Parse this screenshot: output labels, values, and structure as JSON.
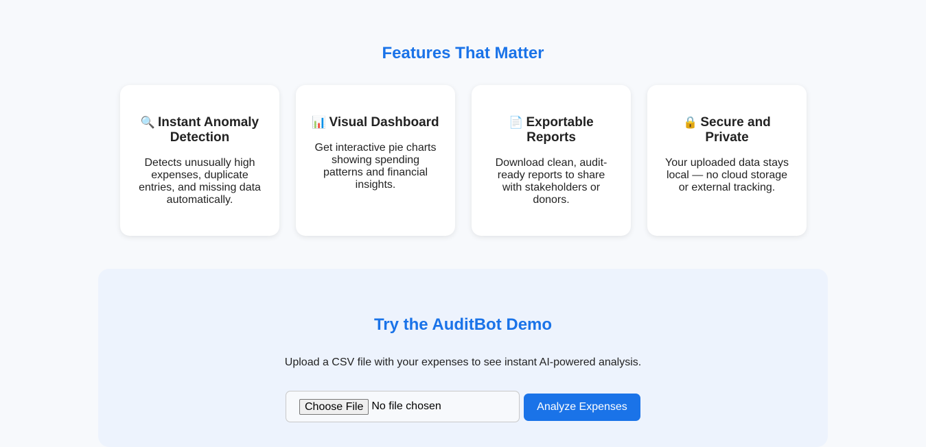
{
  "features": {
    "title": "Features That Matter",
    "cards": [
      {
        "icon_name": "magnifying-glass-icon",
        "icon": "🔍",
        "title": "Instant Anomaly Detection",
        "description": "Detects unusually high expenses, duplicate entries, and missing data automatically."
      },
      {
        "icon_name": "bar-chart-icon",
        "icon": "📊",
        "title": "Visual Dashboard",
        "description": "Get interactive pie charts showing spending patterns and financial insights."
      },
      {
        "icon_name": "document-icon",
        "icon": "📄",
        "title": "Exportable Reports",
        "description": "Download clean, audit-ready reports to share with stakeholders or donors."
      },
      {
        "icon_name": "lock-icon",
        "icon": "🔒",
        "title": "Secure and Private",
        "description": "Your uploaded data stays local — no cloud storage or external tracking."
      }
    ]
  },
  "demo": {
    "title": "Try the AuditBot Demo",
    "description": "Upload a CSV file with your expenses to see instant AI-powered analysis.",
    "choose_file_label": "Choose File",
    "file_status": "No file chosen",
    "analyze_label": "Analyze Expenses"
  },
  "colors": {
    "accent": "#1a73e8",
    "page_background": "#f7f9fc",
    "demo_background": "#edf3fd"
  }
}
